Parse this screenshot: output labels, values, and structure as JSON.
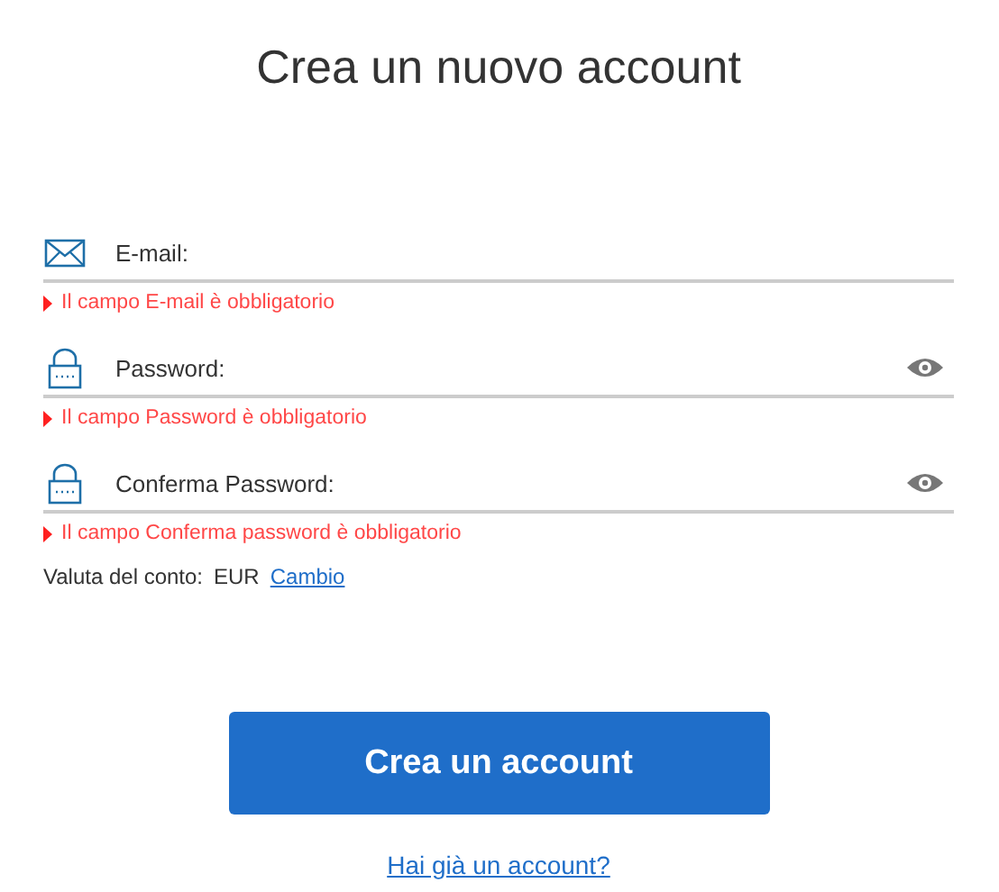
{
  "title": "Crea un nuovo account",
  "fields": [
    {
      "kind": "email",
      "placeholder": "E-mail:",
      "error": "Il campo E-mail è obbligatorio"
    },
    {
      "kind": "password",
      "placeholder": "Password:",
      "error": "Il campo Password è obbligatorio"
    },
    {
      "kind": "password",
      "placeholder": "Conferma Password:",
      "error": "Il campo Conferma password è obbligatorio"
    }
  ],
  "currency": {
    "label": "Valuta del conto:",
    "value": "EUR",
    "link": "Cambio"
  },
  "submit": "Crea un account",
  "login_link": "Hai già un account?"
}
